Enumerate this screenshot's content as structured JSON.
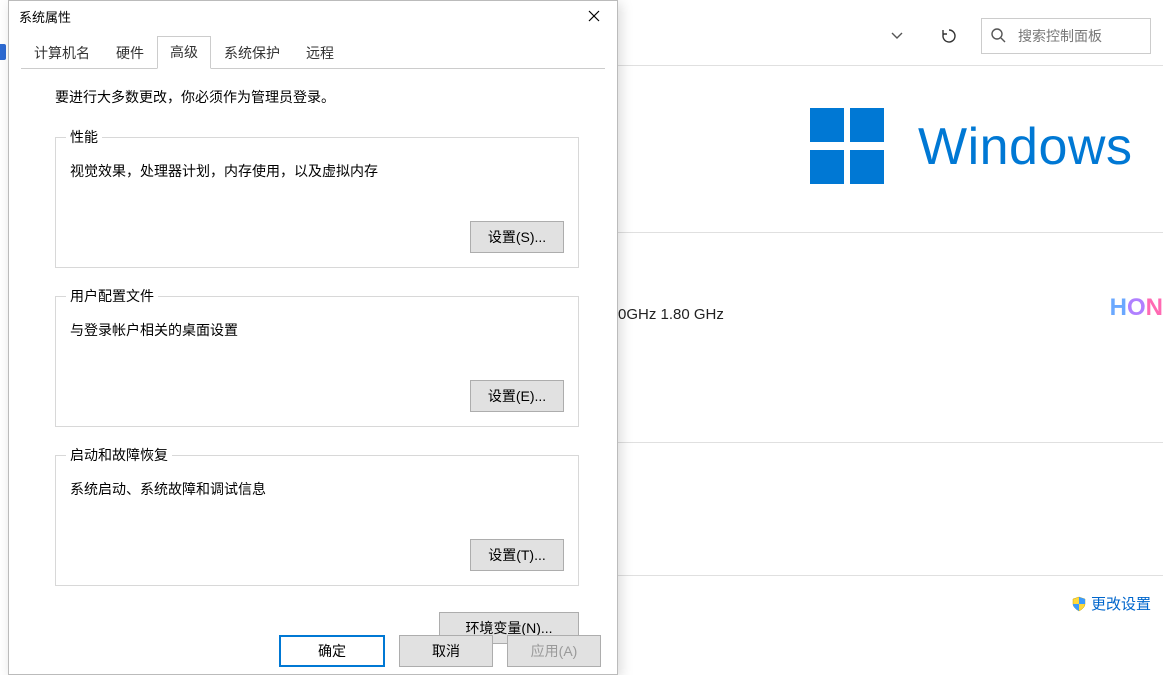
{
  "bg": {
    "search_placeholder": "搜索控制面板",
    "cpu": "0GHz   1.80 GHz",
    "windows_label": "Windows",
    "honor": "HON",
    "change_settings": "更改设置"
  },
  "dialog": {
    "title": "系统属性",
    "tabs": {
      "computer_name": "计算机名",
      "hardware": "硬件",
      "advanced": "高级",
      "system_protection": "系统保护",
      "remote": "远程"
    },
    "admin_msg": "要进行大多数更改，你必须作为管理员登录。",
    "perf": {
      "legend": "性能",
      "desc": "视觉效果，处理器计划，内存使用，以及虚拟内存",
      "btn": "设置(S)..."
    },
    "profile": {
      "legend": "用户配置文件",
      "desc": "与登录帐户相关的桌面设置",
      "btn": "设置(E)..."
    },
    "startup": {
      "legend": "启动和故障恢复",
      "desc": "系统启动、系统故障和调试信息",
      "btn": "设置(T)..."
    },
    "env_btn": "环境变量(N)...",
    "ok": "确定",
    "cancel": "取消",
    "apply": "应用(A)"
  }
}
